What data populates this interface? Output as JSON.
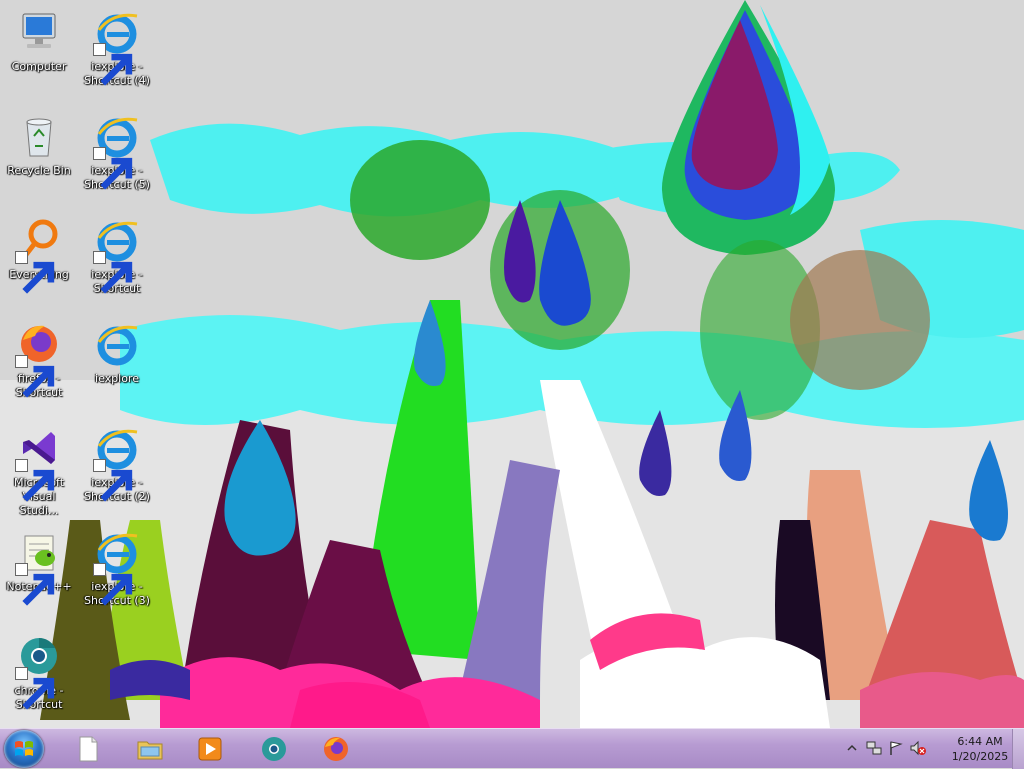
{
  "desktop": {
    "icons": [
      {
        "id": "computer",
        "label": "Computer",
        "icon": "computer-icon",
        "shortcut": false
      },
      {
        "id": "iexplore-4",
        "label": "iexplore - Shortcut (4)",
        "icon": "internet-explorer-icon",
        "shortcut": true
      },
      {
        "id": "recycle-bin",
        "label": "Recycle Bin",
        "icon": "recycle-bin-icon",
        "shortcut": false
      },
      {
        "id": "iexplore-5",
        "label": "iexplore - Shortcut (5)",
        "icon": "internet-explorer-icon",
        "shortcut": true
      },
      {
        "id": "everything",
        "label": "Everything",
        "icon": "everything-search-icon",
        "shortcut": true
      },
      {
        "id": "iexplore-shortcut",
        "label": "iexplore - Shortcut",
        "icon": "internet-explorer-icon",
        "shortcut": true
      },
      {
        "id": "firefox",
        "label": "firefox - Shortcut",
        "icon": "firefox-icon",
        "shortcut": true
      },
      {
        "id": "iexplore",
        "label": "iexplore",
        "icon": "internet-explorer-icon",
        "shortcut": false
      },
      {
        "id": "visual-studio",
        "label": "Microsoft Visual Studi...",
        "icon": "visual-studio-icon",
        "shortcut": true
      },
      {
        "id": "iexplore-2",
        "label": "iexplore - Shortcut (2)",
        "icon": "internet-explorer-icon",
        "shortcut": true
      },
      {
        "id": "notepadpp",
        "label": "Notepad++",
        "icon": "notepad-plus-plus-icon",
        "shortcut": true
      },
      {
        "id": "iexplore-3",
        "label": "iexplore - Shortcut (3)",
        "icon": "internet-explorer-icon",
        "shortcut": true
      },
      {
        "id": "chrome",
        "label": "chrome - Shortcut",
        "icon": "chrome-icon",
        "shortcut": true
      }
    ]
  },
  "taskbar": {
    "start_icon": "windows-start-icon",
    "pinned": [
      {
        "id": "blank-document",
        "icon": "blank-document-icon"
      },
      {
        "id": "file-explorer",
        "icon": "file-explorer-icon"
      },
      {
        "id": "media-player",
        "icon": "media-player-icon"
      },
      {
        "id": "chrome",
        "icon": "chrome-icon"
      },
      {
        "id": "firefox",
        "icon": "firefox-icon"
      }
    ],
    "tray": {
      "icons": [
        "show-hidden-icons-icon",
        "network-icon",
        "action-center-flag-icon",
        "volume-muted-icon"
      ],
      "time": "6:44 AM",
      "date": "1/20/2025"
    }
  }
}
